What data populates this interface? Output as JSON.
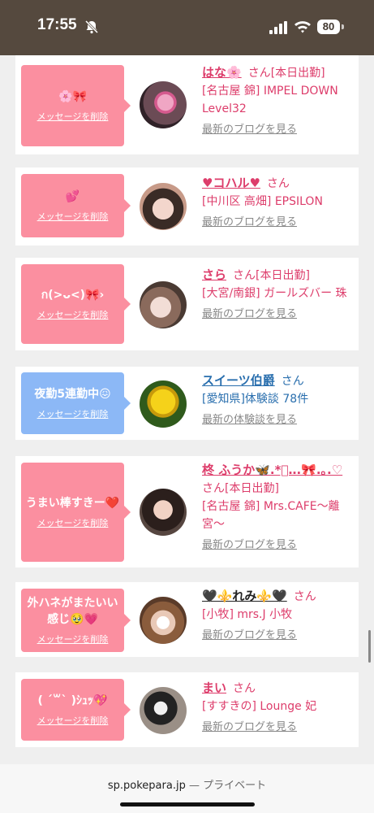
{
  "status": {
    "time": "17:55",
    "battery": "80"
  },
  "cards": [
    {
      "message": "🌸🎀",
      "delete": "メッセージを削除",
      "name": "はな🌸",
      "san": "さん",
      "tag": "[本日出勤]",
      "location": "[名古屋 錦] IMPEL DOWN Level32",
      "link": "最新のブログを見る",
      "bubble_color": "#fb8fa0"
    },
    {
      "message": "💕",
      "delete": "メッセージを削除",
      "name": "♥コハル♥",
      "san": "さん",
      "tag": "",
      "location": "[中川区 高畑] EPSILON",
      "link": "最新のブログを見る",
      "bubble_color": "#fb8fa0"
    },
    {
      "message": "ก(>ᴗ<)🎀›",
      "delete": "メッセージを削除",
      "name": "さら",
      "san": "さん",
      "tag": "[本日出勤]",
      "location": "[大宮/南銀] ガールズバー 珠",
      "link": "最新のブログを見る",
      "bubble_color": "#fb8fa0"
    },
    {
      "message": "夜勤5連勤中😖",
      "delete": "メッセージを削除",
      "name": "スイーツ伯爵",
      "san": "さん",
      "tag": "",
      "location": "[愛知県]体験談 78件",
      "link": "最新の体験談を見る",
      "bubble_color": "#8cb8f6"
    },
    {
      "message": "うまい棒すきー❤️",
      "delete": "メッセージを削除",
      "name": "柊 ふうか🦋.*゚‥.🎀.｡.♡",
      "san": "さん",
      "tag": "[本日出勤]",
      "location": "[名古屋 錦] Mrs.CAFE〜離宮〜",
      "link": "最新のブログを見る",
      "bubble_color": "#fb8fa0"
    },
    {
      "message": "外ハネがまたいい感じ🥹💗",
      "delete": "メッセージを削除",
      "name": "🖤⚜️れみ⚜️🖤",
      "san": "さん",
      "tag": "",
      "location": "[小牧] mrs.J 小牧",
      "link": "最新のブログを見る",
      "bubble_color": "#fb8fa0"
    },
    {
      "message": "( ˊ꒳ˋ )ｼｭｯ💖",
      "delete": "メッセージを削除",
      "name": "まい",
      "san": "さん",
      "tag": "",
      "location": "[すすきの] Lounge 妃",
      "link": "最新のブログを見る",
      "bubble_color": "#fb8fa0"
    }
  ],
  "bottom_bar": {
    "domain": "sp.pokepara.jp",
    "separator": "—",
    "mode": "プライベート"
  }
}
